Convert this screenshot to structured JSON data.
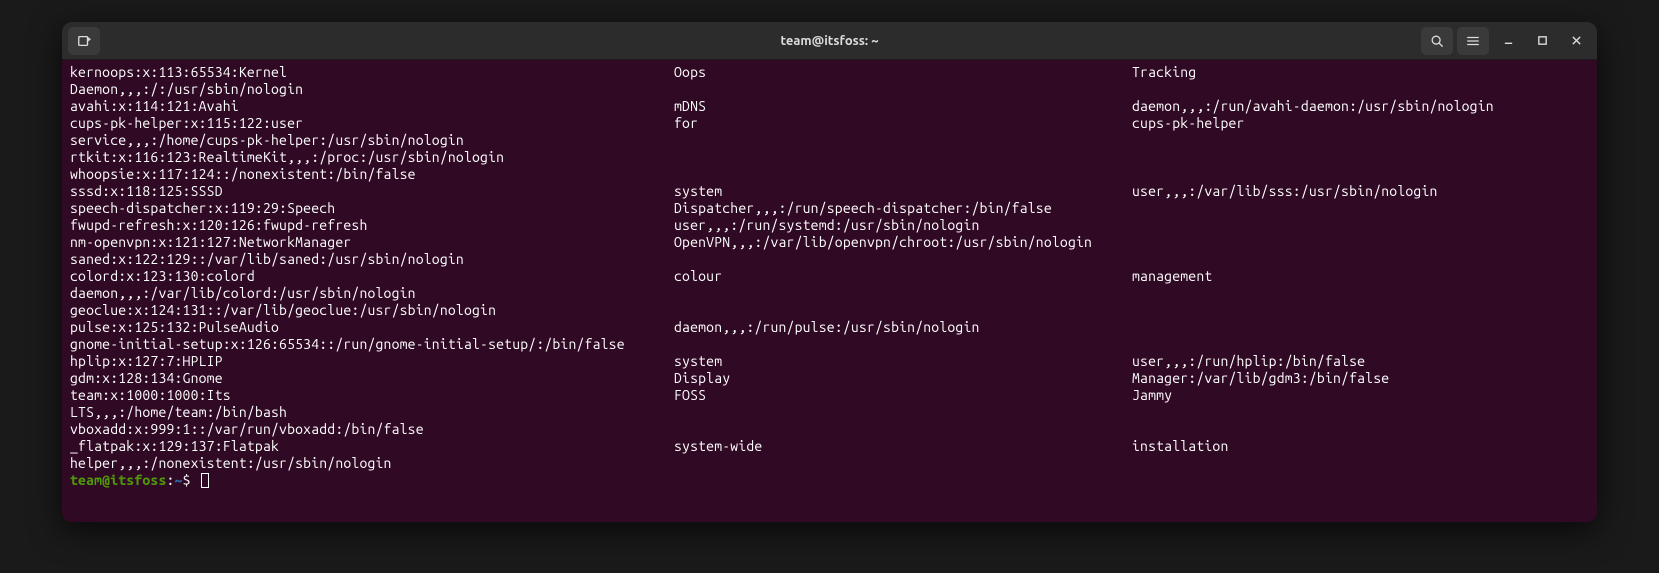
{
  "title": "team@itsfoss: ~",
  "prompt": {
    "userhost": "team@itsfoss",
    "colon": ":",
    "path": "~",
    "dollar": "$ "
  },
  "lines": [
    [
      "kernoops:x:113:65534:Kernel",
      "Oops",
      "Tracking"
    ],
    [
      "Daemon,,,:/:/usr/sbin/nologin",
      "",
      ""
    ],
    [
      "avahi:x:114:121:Avahi",
      "mDNS",
      "daemon,,,:/run/avahi-daemon:/usr/sbin/nologin"
    ],
    [
      "cups-pk-helper:x:115:122:user",
      "for",
      "cups-pk-helper"
    ],
    [
      "service,,,:/home/cups-pk-helper:/usr/sbin/nologin",
      "",
      ""
    ],
    [
      "rtkit:x:116:123:RealtimeKit,,,:/proc:/usr/sbin/nologin",
      "",
      ""
    ],
    [
      "whoopsie:x:117:124::/nonexistent:/bin/false",
      "",
      ""
    ],
    [
      "sssd:x:118:125:SSSD",
      "system",
      "user,,,:/var/lib/sss:/usr/sbin/nologin"
    ],
    [
      "speech-dispatcher:x:119:29:Speech",
      "Dispatcher,,,:/run/speech-dispatcher:/bin/false",
      ""
    ],
    [
      "fwupd-refresh:x:120:126:fwupd-refresh",
      "user,,,:/run/systemd:/usr/sbin/nologin",
      ""
    ],
    [
      "nm-openvpn:x:121:127:NetworkManager",
      "OpenVPN,,,:/var/lib/openvpn/chroot:/usr/sbin/nologin",
      ""
    ],
    [
      "saned:x:122:129::/var/lib/saned:/usr/sbin/nologin",
      "",
      ""
    ],
    [
      "colord:x:123:130:colord",
      "colour",
      "management"
    ],
    [
      "daemon,,,:/var/lib/colord:/usr/sbin/nologin",
      "",
      ""
    ],
    [
      "geoclue:x:124:131::/var/lib/geoclue:/usr/sbin/nologin",
      "",
      ""
    ],
    [
      "pulse:x:125:132:PulseAudio",
      "daemon,,,:/run/pulse:/usr/sbin/nologin",
      ""
    ],
    [
      "gnome-initial-setup:x:126:65534::/run/gnome-initial-setup/:/bin/false",
      "",
      ""
    ],
    [
      "hplip:x:127:7:HPLIP",
      "system",
      "user,,,:/run/hplip:/bin/false"
    ],
    [
      "gdm:x:128:134:Gnome",
      "Display",
      "Manager:/var/lib/gdm3:/bin/false"
    ],
    [
      "team:x:1000:1000:Its",
      "FOSS",
      "Jammy"
    ],
    [
      "LTS,,,:/home/team:/bin/bash",
      "",
      ""
    ],
    [
      "vboxadd:x:999:1::/var/run/vboxadd:/bin/false",
      "",
      ""
    ],
    [
      "_flatpak:x:129:137:Flatpak",
      "system-wide",
      "installation"
    ],
    [
      "helper,,,:/nonexistent:/usr/sbin/nologin",
      "",
      ""
    ]
  ]
}
